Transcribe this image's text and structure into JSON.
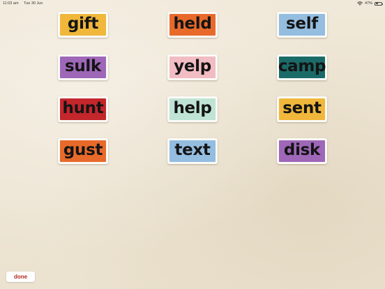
{
  "status_bar": {
    "time": "11:03 am",
    "date": "Tue 30 Jun",
    "battery": "47%",
    "battery_level": 0.47
  },
  "cards": [
    {
      "word": "gift",
      "color": "#f0b73b"
    },
    {
      "word": "held",
      "color": "#e86a2a"
    },
    {
      "word": "self",
      "color": "#94bde0"
    },
    {
      "word": "sulk",
      "color": "#9e67b8"
    },
    {
      "word": "yelp",
      "color": "#f1bcc3"
    },
    {
      "word": "camp",
      "color": "#1a6b68"
    },
    {
      "word": "hunt",
      "color": "#c3262b"
    },
    {
      "word": "help",
      "color": "#bfe3d4"
    },
    {
      "word": "sent",
      "color": "#f0b73b"
    },
    {
      "word": "gust",
      "color": "#e86a2a"
    },
    {
      "word": "text",
      "color": "#94bde0"
    },
    {
      "word": "disk",
      "color": "#9e67b8"
    }
  ],
  "done_button": {
    "label": "done"
  }
}
